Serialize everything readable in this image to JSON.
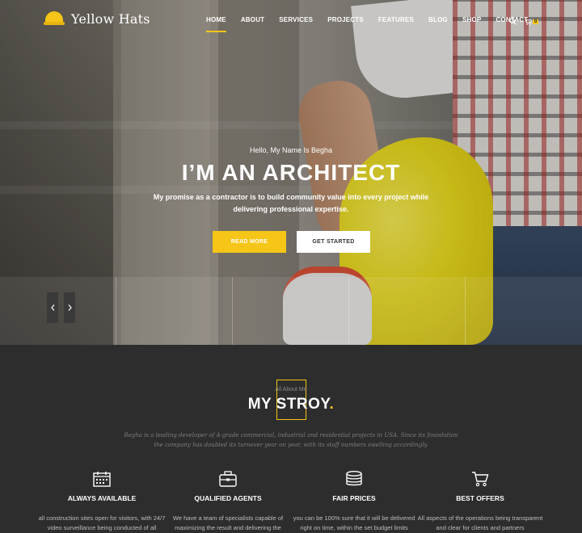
{
  "brand": {
    "name": "Yellow Hats",
    "accent": "#f5c518",
    "logo_icon": "hard-hat-icon"
  },
  "nav": {
    "items": [
      "HOME",
      "ABOUT",
      "SERVICES",
      "PROJECTS",
      "FEATURES",
      "BLOG",
      "SHOP",
      "CONTACT"
    ],
    "active": "HOME",
    "search_icon": "search-icon",
    "cart_icon": "cart-icon",
    "cart_count": "0"
  },
  "hero": {
    "greeting": "Hello, My Name Is Begha",
    "headline": "I’M AN ARCHITECT",
    "subtitle": "My promise as a contractor is to build community value into every project while delivering professional expertise.",
    "primary_button": "READ MORE",
    "secondary_button": "GET STARTED",
    "prev_icon": "chevron-left-icon",
    "next_icon": "chevron-right-icon"
  },
  "about": {
    "eyebrow": "All About Me",
    "title": "MY STROY",
    "title_dot": ".",
    "description": "Begha is a leading developer of A-grade commercial, industrial and residential projects in USA. Since its foundation the company has doubled its turnover year on year, with its staff numbers swelling accordingly.",
    "features": [
      {
        "icon": "calendar-icon",
        "title": "ALWAYS AVAILABLE",
        "text": "all construction sites open for visitors, with 24/7 video surveillance being conducted of all objects"
      },
      {
        "icon": "briefcase-icon",
        "title": "QUALIFIED AGENTS",
        "text": "We have a team of specialists capable of maximizing the result and delivering the projects"
      },
      {
        "icon": "database-icon",
        "title": "FAIR PRICES",
        "text": "you can be 100% sure that it will be delivered right on time, within the set budget limits"
      },
      {
        "icon": "cart-icon",
        "title": "BEST OFFERS",
        "text": "All aspects of the operations being transparent and clear for clients and partners"
      }
    ]
  }
}
